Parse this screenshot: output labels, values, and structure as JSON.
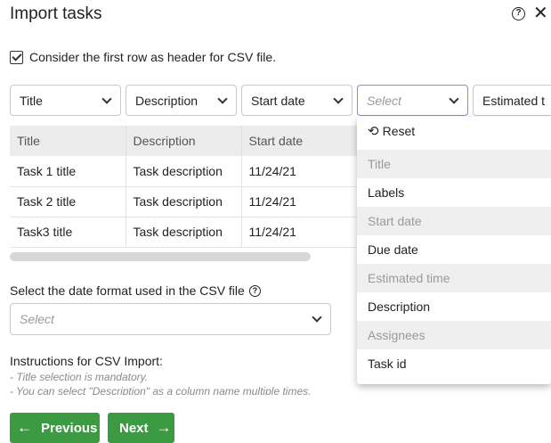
{
  "dialog": {
    "title": "Import tasks",
    "help_icon": "help-circle-icon",
    "close_icon": "close-icon"
  },
  "header_checkbox": {
    "checked": true,
    "label": "Consider the first row as header for CSV file."
  },
  "column_selects": [
    {
      "value": "Title",
      "placeholder": false
    },
    {
      "value": "Description",
      "placeholder": false
    },
    {
      "value": "Start date",
      "placeholder": false
    },
    {
      "value": "Select",
      "placeholder": true,
      "open": true
    },
    {
      "value": "Estimated t",
      "placeholder": false
    }
  ],
  "preview_table": {
    "headers": [
      "Title",
      "Description",
      "Start date"
    ],
    "rows": [
      [
        "Task 1 title",
        "Task description",
        "11/24/21"
      ],
      [
        "Task 2 title",
        "Task description",
        "11/24/21"
      ],
      [
        "Task3 title",
        "Task description",
        "11/24/21"
      ]
    ]
  },
  "dropdown": {
    "reset_label": "Reset",
    "reset_icon": "undo-icon",
    "options": [
      {
        "label": "Title",
        "disabled": true
      },
      {
        "label": "Labels",
        "disabled": false
      },
      {
        "label": "Start date",
        "disabled": true
      },
      {
        "label": "Due date",
        "disabled": false
      },
      {
        "label": "Estimated time",
        "disabled": true
      },
      {
        "label": "Description",
        "disabled": false
      },
      {
        "label": "Assignees",
        "disabled": true
      },
      {
        "label": "Task id",
        "disabled": false
      }
    ]
  },
  "date_format": {
    "label": "Select the date format used in the CSV file",
    "help_icon": "help-circle-icon",
    "placeholder": "Select"
  },
  "instructions": {
    "title": "Instructions for CSV Import:",
    "lines": [
      "- Title selection is mandatory.",
      "- You can select \"Description\" as a column name multiple times."
    ]
  },
  "buttons": {
    "previous": "Previous",
    "next": "Next"
  },
  "colors": {
    "primary_button": "#3c9a43",
    "active_border": "#6f98d6"
  }
}
